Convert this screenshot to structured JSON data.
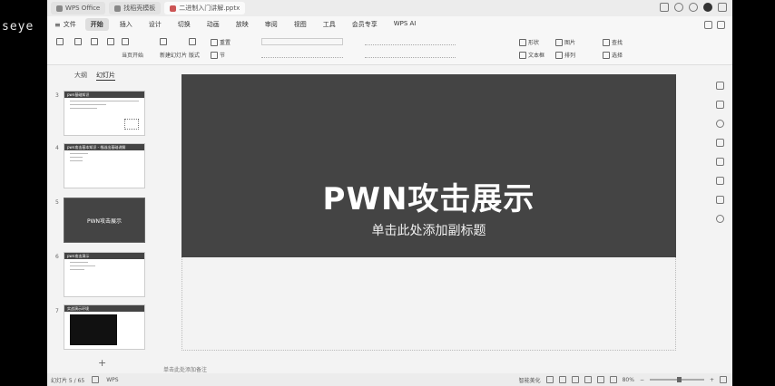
{
  "overlay": {
    "text": "seye"
  },
  "titlebar": {
    "tabs": [
      {
        "label": "WPS Office"
      },
      {
        "label": "找稻壳模板"
      },
      {
        "label": "二进制入门讲解.pptx"
      }
    ]
  },
  "menu": {
    "file_label": "文件",
    "items": [
      "开始",
      "插入",
      "设计",
      "切换",
      "动画",
      "放映",
      "审阅",
      "视图",
      "工具",
      "会员专享",
      "WPS AI"
    ],
    "active_index": 0
  },
  "ribbon": {
    "new_slide": "新建幻灯片",
    "layout": "版式",
    "section": "节",
    "textbox": "文本框",
    "arrange": "排列",
    "shape": "形状",
    "image": "图片",
    "find": "查找",
    "select": "选择",
    "from_current": "当页开始",
    "reset": "重置"
  },
  "leftpanel": {
    "tabs": [
      "大纲",
      "幻灯片"
    ],
    "active_tab": 1,
    "slides": [
      {
        "num": "3",
        "header": "pwn基础知识"
      },
      {
        "num": "4",
        "header": "pwn攻击基本知识 - 栈溢出基础讲解"
      },
      {
        "num": "5",
        "title": "PWN攻击展示"
      },
      {
        "num": "6",
        "header": "pwn攻击演示"
      },
      {
        "num": "7",
        "header": "实战演示环境"
      }
    ],
    "add_label": "+"
  },
  "slide": {
    "title": "PWN攻击展示",
    "subtitle": "单击此处添加副标题"
  },
  "notes": {
    "placeholder": "单击此处添加备注"
  },
  "status": {
    "page": "幻灯片 5 / 65",
    "app": "WPS",
    "zoom": "80%",
    "notes_btn": "智能美化",
    "zoom_level": 0.55
  }
}
